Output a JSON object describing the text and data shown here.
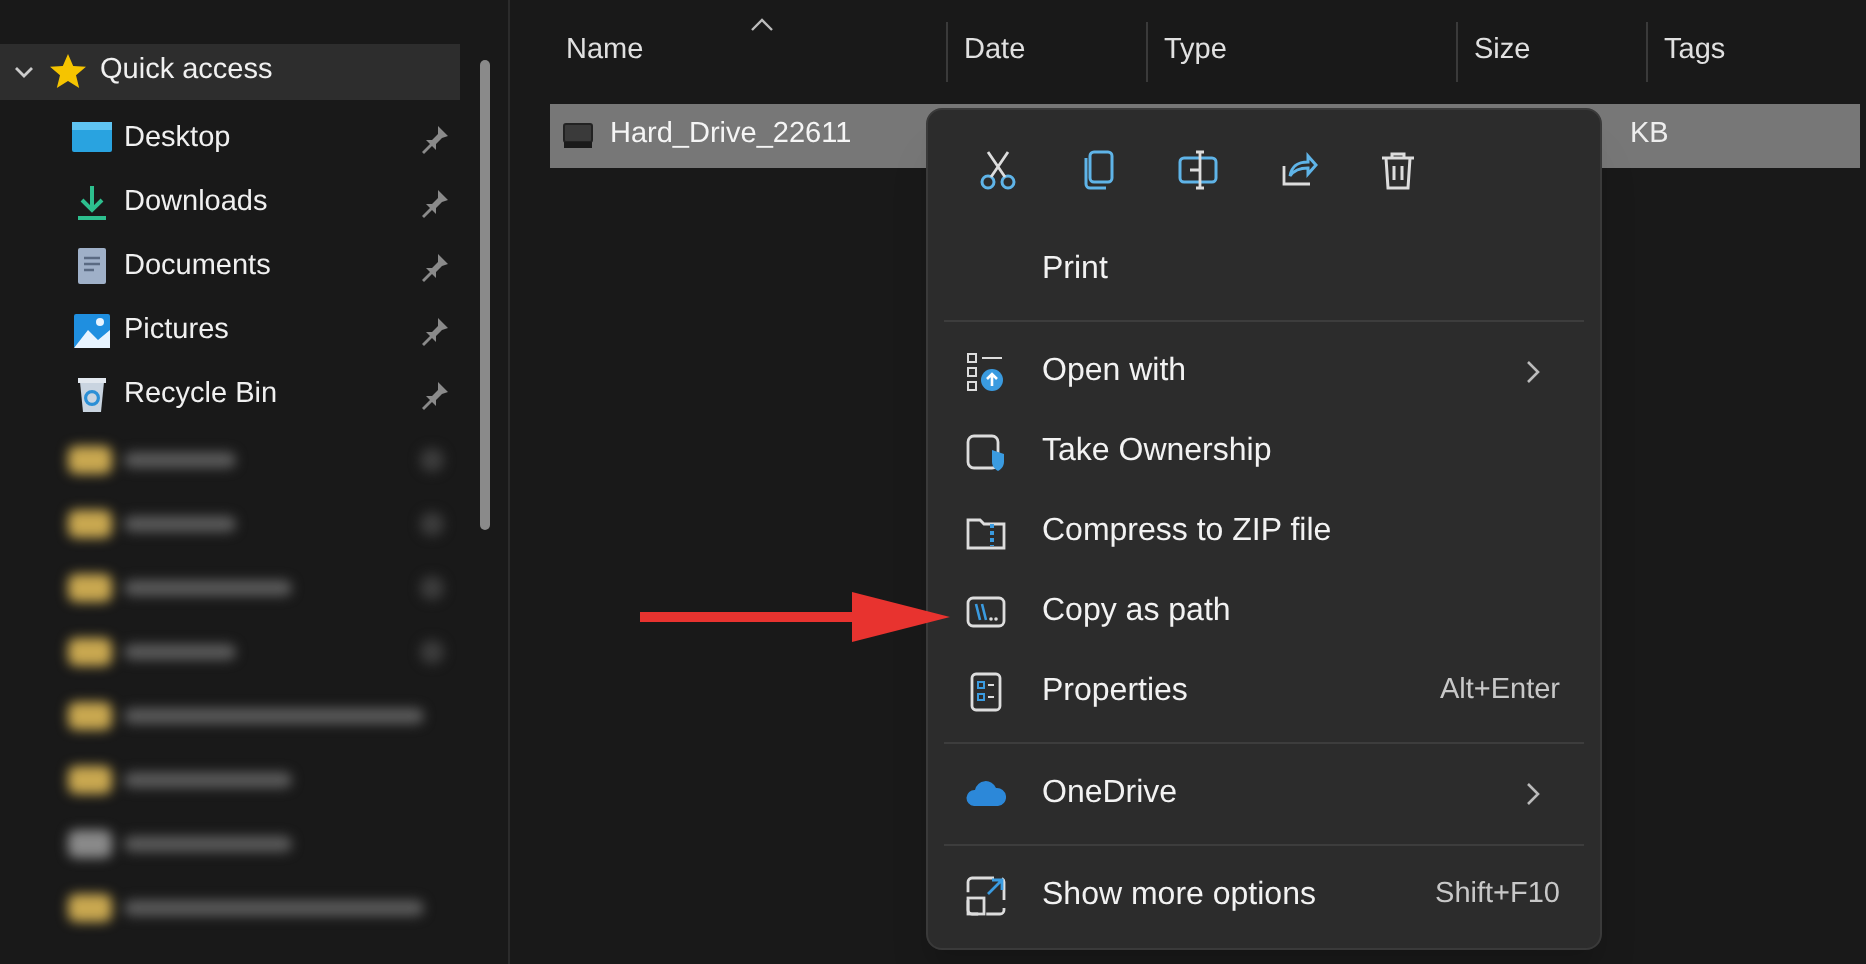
{
  "sidebar": {
    "section": {
      "label": "Quick access",
      "expanded": true,
      "selected": true
    },
    "items": [
      {
        "label": "Desktop",
        "pinned": true
      },
      {
        "label": "Downloads",
        "pinned": true
      },
      {
        "label": "Documents",
        "pinned": true
      },
      {
        "label": "Pictures",
        "pinned": true
      },
      {
        "label": "Recycle Bin",
        "pinned": true
      }
    ],
    "blurred_items": [
      {
        "kind": "folder",
        "pinned": true
      },
      {
        "kind": "folder",
        "pinned": true
      },
      {
        "kind": "folder",
        "pinned": true
      },
      {
        "kind": "folder",
        "pinned": true
      },
      {
        "kind": "folder",
        "pinned": false
      },
      {
        "kind": "folder",
        "pinned": false
      },
      {
        "kind": "drive",
        "pinned": false
      },
      {
        "kind": "folder",
        "pinned": false
      }
    ]
  },
  "table": {
    "columns": [
      "Name",
      "Date",
      "Type",
      "Size",
      "Tags"
    ],
    "rows": [
      {
        "name": "Hard_Drive_22611",
        "size": "KB",
        "selected": true
      }
    ]
  },
  "context_menu": {
    "items": [
      {
        "kind": "item",
        "label": "Print"
      },
      {
        "kind": "separator"
      },
      {
        "kind": "item",
        "label": "Open with",
        "submenu": true
      },
      {
        "kind": "item",
        "label": "Take Ownership"
      },
      {
        "kind": "item",
        "label": "Compress to ZIP file"
      },
      {
        "kind": "item",
        "label": "Copy as path",
        "highlighted_by_arrow": true
      },
      {
        "kind": "item",
        "label": "Properties",
        "shortcut": "Alt+Enter"
      },
      {
        "kind": "separator"
      },
      {
        "kind": "item",
        "label": "OneDrive",
        "submenu": true
      },
      {
        "kind": "separator"
      },
      {
        "kind": "item",
        "label": "Show more options",
        "shortcut": "Shift+F10"
      }
    ]
  }
}
